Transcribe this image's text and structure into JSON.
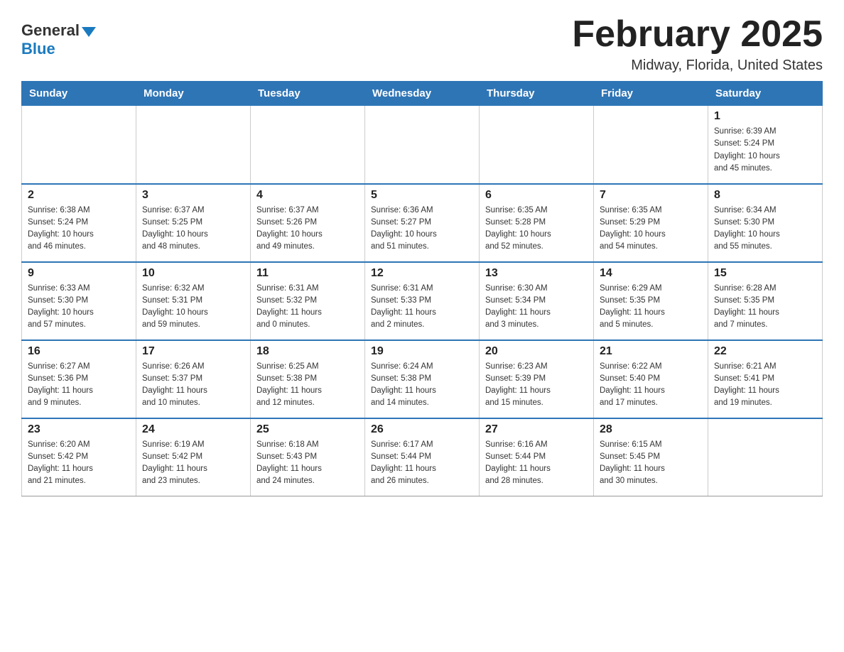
{
  "header": {
    "logo_general": "General",
    "logo_blue": "Blue",
    "month_title": "February 2025",
    "location": "Midway, Florida, United States"
  },
  "weekdays": [
    "Sunday",
    "Monday",
    "Tuesday",
    "Wednesday",
    "Thursday",
    "Friday",
    "Saturday"
  ],
  "weeks": [
    [
      {
        "day": "",
        "info": ""
      },
      {
        "day": "",
        "info": ""
      },
      {
        "day": "",
        "info": ""
      },
      {
        "day": "",
        "info": ""
      },
      {
        "day": "",
        "info": ""
      },
      {
        "day": "",
        "info": ""
      },
      {
        "day": "1",
        "info": "Sunrise: 6:39 AM\nSunset: 5:24 PM\nDaylight: 10 hours\nand 45 minutes."
      }
    ],
    [
      {
        "day": "2",
        "info": "Sunrise: 6:38 AM\nSunset: 5:24 PM\nDaylight: 10 hours\nand 46 minutes."
      },
      {
        "day": "3",
        "info": "Sunrise: 6:37 AM\nSunset: 5:25 PM\nDaylight: 10 hours\nand 48 minutes."
      },
      {
        "day": "4",
        "info": "Sunrise: 6:37 AM\nSunset: 5:26 PM\nDaylight: 10 hours\nand 49 minutes."
      },
      {
        "day": "5",
        "info": "Sunrise: 6:36 AM\nSunset: 5:27 PM\nDaylight: 10 hours\nand 51 minutes."
      },
      {
        "day": "6",
        "info": "Sunrise: 6:35 AM\nSunset: 5:28 PM\nDaylight: 10 hours\nand 52 minutes."
      },
      {
        "day": "7",
        "info": "Sunrise: 6:35 AM\nSunset: 5:29 PM\nDaylight: 10 hours\nand 54 minutes."
      },
      {
        "day": "8",
        "info": "Sunrise: 6:34 AM\nSunset: 5:30 PM\nDaylight: 10 hours\nand 55 minutes."
      }
    ],
    [
      {
        "day": "9",
        "info": "Sunrise: 6:33 AM\nSunset: 5:30 PM\nDaylight: 10 hours\nand 57 minutes."
      },
      {
        "day": "10",
        "info": "Sunrise: 6:32 AM\nSunset: 5:31 PM\nDaylight: 10 hours\nand 59 minutes."
      },
      {
        "day": "11",
        "info": "Sunrise: 6:31 AM\nSunset: 5:32 PM\nDaylight: 11 hours\nand 0 minutes."
      },
      {
        "day": "12",
        "info": "Sunrise: 6:31 AM\nSunset: 5:33 PM\nDaylight: 11 hours\nand 2 minutes."
      },
      {
        "day": "13",
        "info": "Sunrise: 6:30 AM\nSunset: 5:34 PM\nDaylight: 11 hours\nand 3 minutes."
      },
      {
        "day": "14",
        "info": "Sunrise: 6:29 AM\nSunset: 5:35 PM\nDaylight: 11 hours\nand 5 minutes."
      },
      {
        "day": "15",
        "info": "Sunrise: 6:28 AM\nSunset: 5:35 PM\nDaylight: 11 hours\nand 7 minutes."
      }
    ],
    [
      {
        "day": "16",
        "info": "Sunrise: 6:27 AM\nSunset: 5:36 PM\nDaylight: 11 hours\nand 9 minutes."
      },
      {
        "day": "17",
        "info": "Sunrise: 6:26 AM\nSunset: 5:37 PM\nDaylight: 11 hours\nand 10 minutes."
      },
      {
        "day": "18",
        "info": "Sunrise: 6:25 AM\nSunset: 5:38 PM\nDaylight: 11 hours\nand 12 minutes."
      },
      {
        "day": "19",
        "info": "Sunrise: 6:24 AM\nSunset: 5:38 PM\nDaylight: 11 hours\nand 14 minutes."
      },
      {
        "day": "20",
        "info": "Sunrise: 6:23 AM\nSunset: 5:39 PM\nDaylight: 11 hours\nand 15 minutes."
      },
      {
        "day": "21",
        "info": "Sunrise: 6:22 AM\nSunset: 5:40 PM\nDaylight: 11 hours\nand 17 minutes."
      },
      {
        "day": "22",
        "info": "Sunrise: 6:21 AM\nSunset: 5:41 PM\nDaylight: 11 hours\nand 19 minutes."
      }
    ],
    [
      {
        "day": "23",
        "info": "Sunrise: 6:20 AM\nSunset: 5:42 PM\nDaylight: 11 hours\nand 21 minutes."
      },
      {
        "day": "24",
        "info": "Sunrise: 6:19 AM\nSunset: 5:42 PM\nDaylight: 11 hours\nand 23 minutes."
      },
      {
        "day": "25",
        "info": "Sunrise: 6:18 AM\nSunset: 5:43 PM\nDaylight: 11 hours\nand 24 minutes."
      },
      {
        "day": "26",
        "info": "Sunrise: 6:17 AM\nSunset: 5:44 PM\nDaylight: 11 hours\nand 26 minutes."
      },
      {
        "day": "27",
        "info": "Sunrise: 6:16 AM\nSunset: 5:44 PM\nDaylight: 11 hours\nand 28 minutes."
      },
      {
        "day": "28",
        "info": "Sunrise: 6:15 AM\nSunset: 5:45 PM\nDaylight: 11 hours\nand 30 minutes."
      },
      {
        "day": "",
        "info": ""
      }
    ]
  ]
}
